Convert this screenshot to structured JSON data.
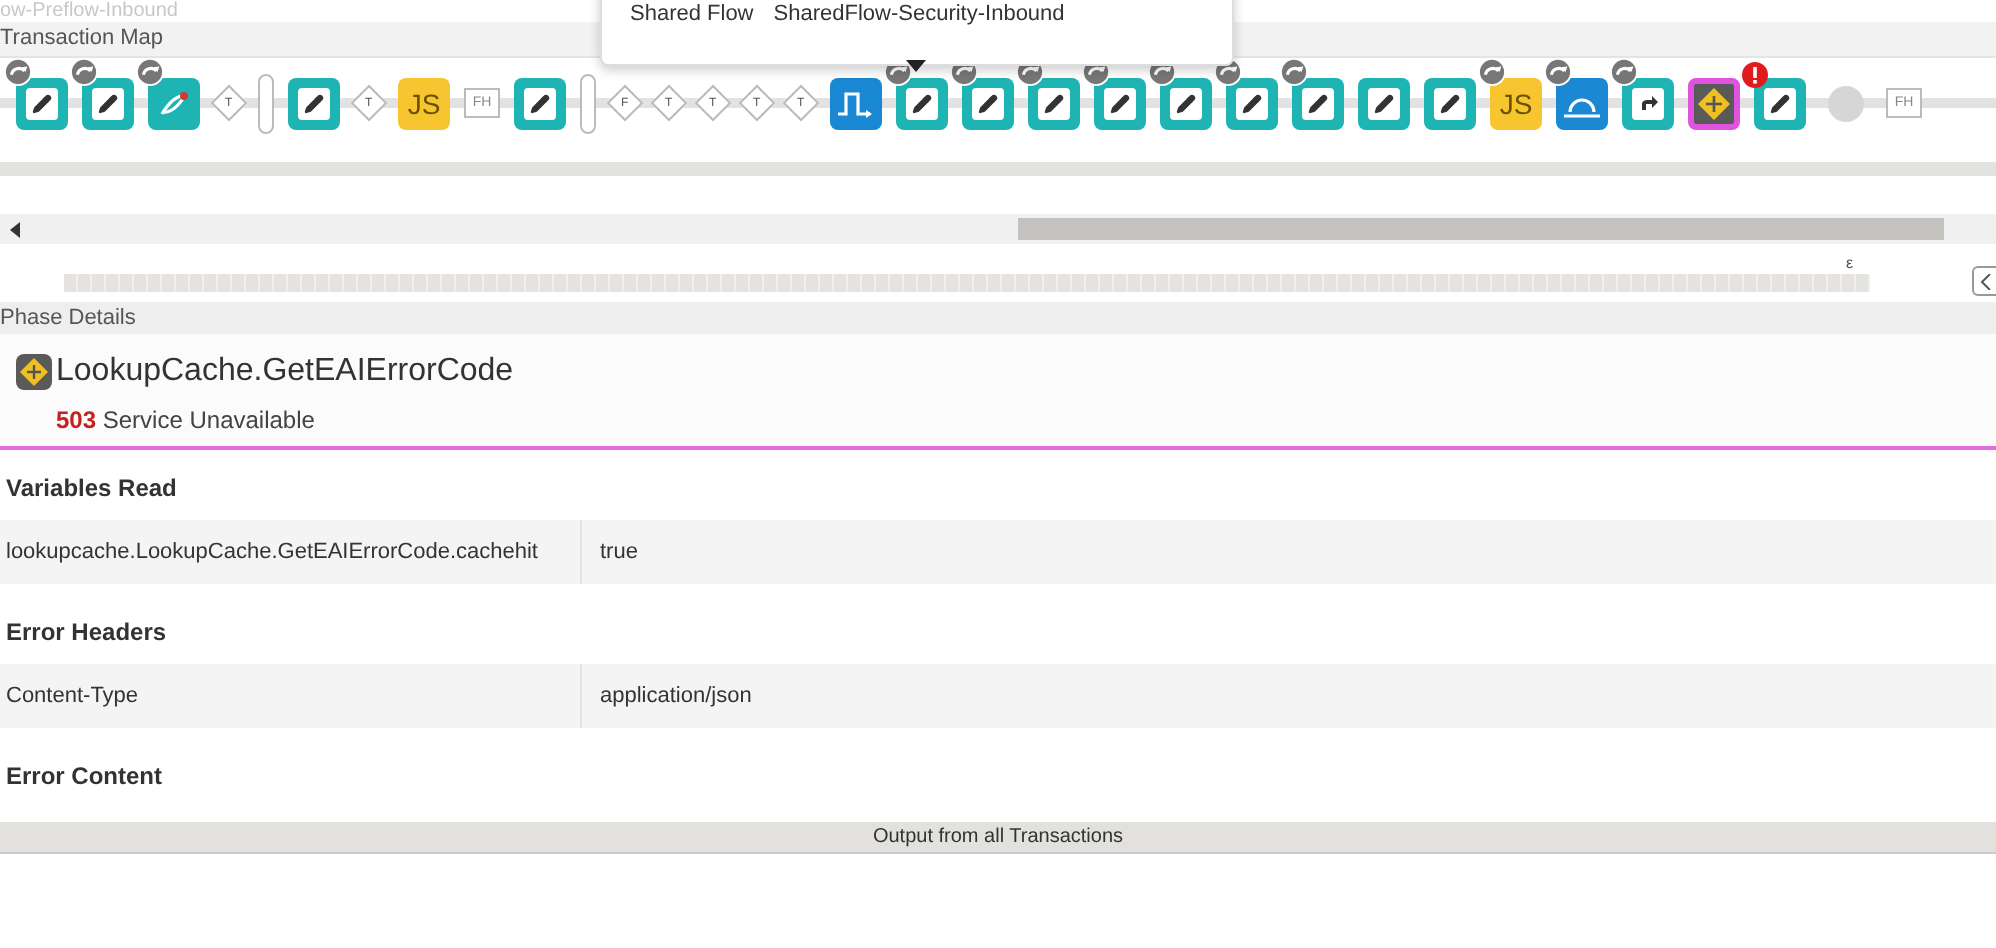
{
  "faded_popup": {
    "text": "ow-Preflow-Inbound"
  },
  "transaction_map": {
    "title": "Transaction Map"
  },
  "tooltip": {
    "label": "Shared Flow",
    "value": "SharedFlow-Security-Inbound"
  },
  "nodes": [
    {
      "kind": "policy",
      "executed": true,
      "error": false,
      "selected": false
    },
    {
      "kind": "policy",
      "executed": true,
      "error": false,
      "selected": false
    },
    {
      "kind": "swap",
      "executed": true,
      "error": false,
      "selected": false
    },
    {
      "kind": "cond",
      "text": "T",
      "executed": false,
      "error": false,
      "selected": false
    },
    {
      "kind": "divider",
      "executed": false,
      "error": false,
      "selected": false
    },
    {
      "kind": "policy",
      "executed": false,
      "error": false,
      "selected": false
    },
    {
      "kind": "cond",
      "text": "T",
      "executed": false,
      "error": false,
      "selected": false
    },
    {
      "kind": "js",
      "text": "JS",
      "executed": false,
      "error": false,
      "selected": false
    },
    {
      "kind": "fh",
      "text": "FH",
      "executed": false,
      "error": false,
      "selected": false
    },
    {
      "kind": "policy",
      "executed": false,
      "error": false,
      "selected": false
    },
    {
      "kind": "divider",
      "executed": false,
      "error": false,
      "selected": false
    },
    {
      "kind": "cond",
      "text": "F",
      "executed": false,
      "error": false,
      "selected": false
    },
    {
      "kind": "cond",
      "text": "T",
      "executed": false,
      "error": false,
      "selected": false
    },
    {
      "kind": "cond",
      "text": "T",
      "executed": false,
      "error": false,
      "selected": false
    },
    {
      "kind": "cond",
      "text": "T",
      "executed": false,
      "error": false,
      "selected": false
    },
    {
      "kind": "cond",
      "text": "T",
      "executed": false,
      "error": false,
      "selected": false
    },
    {
      "kind": "flow",
      "executed": false,
      "error": false,
      "selected": false
    },
    {
      "kind": "policy",
      "executed": true,
      "error": false,
      "selected": false
    },
    {
      "kind": "policy",
      "executed": true,
      "error": false,
      "selected": false
    },
    {
      "kind": "policy",
      "executed": true,
      "error": false,
      "selected": false
    },
    {
      "kind": "policy",
      "executed": true,
      "error": false,
      "selected": false
    },
    {
      "kind": "policy",
      "executed": true,
      "error": false,
      "selected": false
    },
    {
      "kind": "policy",
      "executed": true,
      "error": false,
      "selected": false
    },
    {
      "kind": "policy",
      "executed": true,
      "error": false,
      "selected": false
    },
    {
      "kind": "policy",
      "executed": false,
      "error": false,
      "selected": false
    },
    {
      "kind": "policy",
      "executed": false,
      "error": false,
      "selected": false
    },
    {
      "kind": "js",
      "text": "JS",
      "executed": true,
      "error": false,
      "selected": false
    },
    {
      "kind": "loop",
      "executed": true,
      "error": false,
      "selected": false
    },
    {
      "kind": "forward",
      "executed": true,
      "error": false,
      "selected": false
    },
    {
      "kind": "decision",
      "executed": false,
      "error": false,
      "selected": true
    },
    {
      "kind": "policy",
      "executed": false,
      "error": true,
      "selected": false
    },
    {
      "kind": "circle",
      "executed": false,
      "error": false,
      "selected": false
    },
    {
      "kind": "fh",
      "text": "FH",
      "executed": false,
      "error": false,
      "selected": false
    }
  ],
  "minimap": {
    "marker": "ε"
  },
  "phase_details": {
    "header": "Phase Details",
    "title": "LookupCache.GetEAIErrorCode",
    "status_code": "503",
    "status_text": "Service Unavailable"
  },
  "sections": [
    {
      "title": "Variables Read",
      "rows": [
        {
          "name": "lookupcache.LookupCache.GetEAIErrorCode.cachehit",
          "value": "true"
        }
      ]
    },
    {
      "title": "Error Headers",
      "rows": [
        {
          "name": "Content-Type",
          "value": "application/json"
        }
      ]
    },
    {
      "title": "Error Content"
    }
  ],
  "output_bar": {
    "label": "Output from all Transactions"
  }
}
